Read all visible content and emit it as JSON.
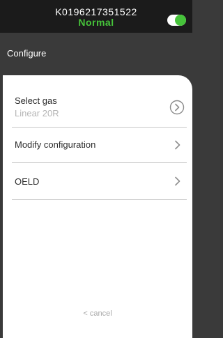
{
  "header": {
    "device_id": "K0196217351522",
    "status": "Normal"
  },
  "page": {
    "title": "Configure"
  },
  "menu": {
    "items": [
      {
        "label": "Select gas",
        "sublabel": "Linear 20R",
        "icon": "circle-chevron-right-icon"
      },
      {
        "label": "Modify configuration",
        "icon": "chevron-right-icon"
      },
      {
        "label": "OELD",
        "icon": "chevron-right-icon"
      }
    ]
  },
  "footer": {
    "cancel_label": "< cancel"
  },
  "colors": {
    "status": "#46c33a",
    "header_bg": "#1b1b1b",
    "title_bar_bg": "#3a3a3a",
    "divider": "#c8c8c8"
  }
}
